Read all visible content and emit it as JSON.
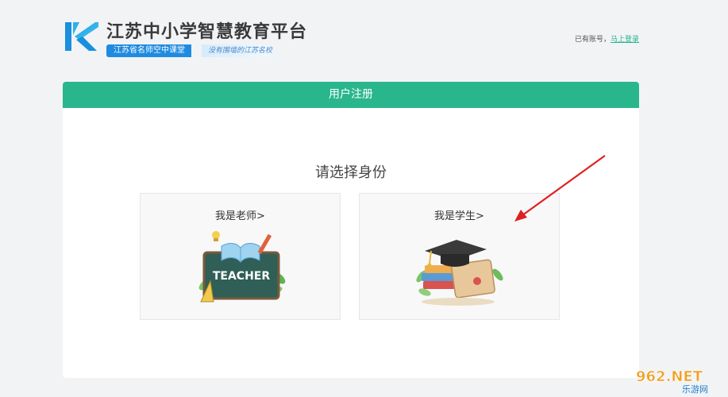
{
  "header": {
    "title": "江苏中小学智慧教育平台",
    "tag_primary": "江苏省名师空中课堂",
    "tag_secondary": "没有围墙的江苏名校",
    "login_prompt": "已有账号，",
    "login_link": "马上登录"
  },
  "card": {
    "header_title": "用户注册",
    "choose_title": "请选择身份",
    "roles": [
      {
        "label": "我是老师>",
        "illustration": "teacher-illustration",
        "illustration_text": "TEACHER"
      },
      {
        "label": "我是学生>",
        "illustration": "student-illustration"
      }
    ]
  },
  "watermark": {
    "main": "962.NET",
    "sub": "乐游网"
  },
  "colors": {
    "accent": "#2ab68c",
    "brand_blue": "#1f8be0",
    "arrow_red": "#e02020"
  }
}
